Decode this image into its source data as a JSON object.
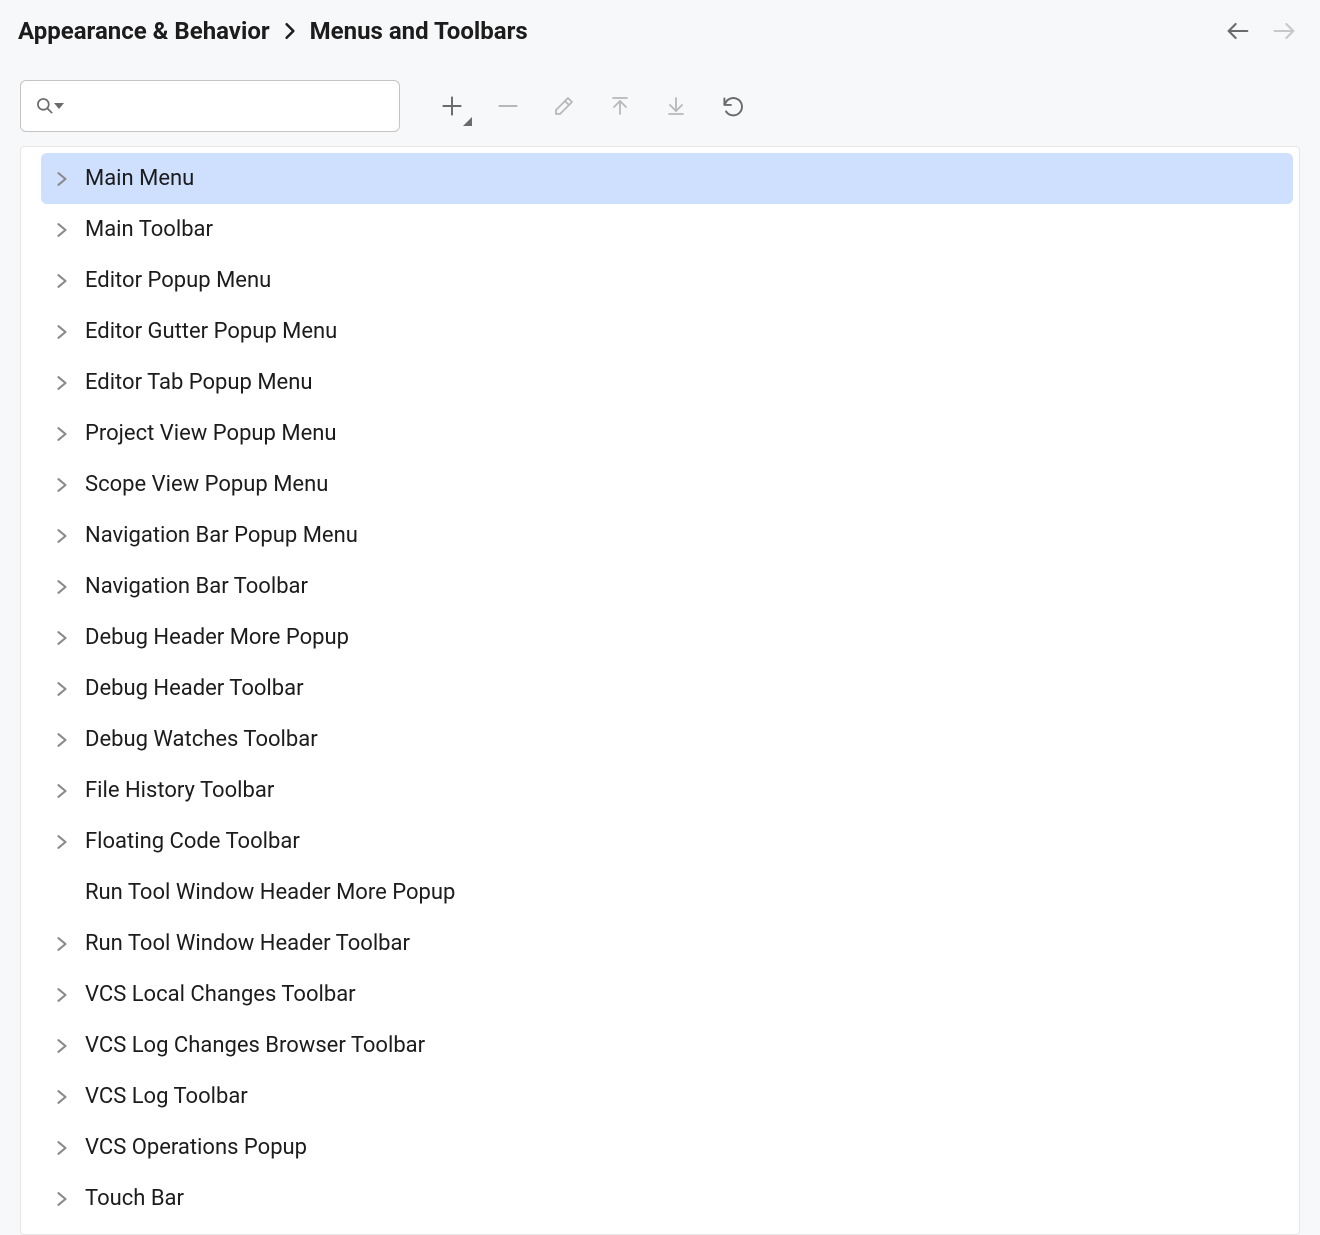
{
  "breadcrumb": {
    "parent": "Appearance & Behavior",
    "current": "Menus and Toolbars"
  },
  "search": {
    "value": "",
    "placeholder": ""
  },
  "actions": {
    "add": "Add",
    "remove": "Remove",
    "edit": "Edit",
    "move_up": "Move Up",
    "move_down": "Move Down",
    "reset": "Reset"
  },
  "selected_index": 0,
  "tree": [
    {
      "label": "Main Menu",
      "expandable": true
    },
    {
      "label": "Main Toolbar",
      "expandable": true
    },
    {
      "label": "Editor Popup Menu",
      "expandable": true
    },
    {
      "label": "Editor Gutter Popup Menu",
      "expandable": true
    },
    {
      "label": "Editor Tab Popup Menu",
      "expandable": true
    },
    {
      "label": "Project View Popup Menu",
      "expandable": true
    },
    {
      "label": "Scope View Popup Menu",
      "expandable": true
    },
    {
      "label": "Navigation Bar Popup Menu",
      "expandable": true
    },
    {
      "label": "Navigation Bar Toolbar",
      "expandable": true
    },
    {
      "label": "Debug Header More Popup",
      "expandable": true
    },
    {
      "label": "Debug Header Toolbar",
      "expandable": true
    },
    {
      "label": "Debug Watches Toolbar",
      "expandable": true
    },
    {
      "label": "File History Toolbar",
      "expandable": true
    },
    {
      "label": "Floating Code Toolbar",
      "expandable": true
    },
    {
      "label": "Run Tool Window Header More Popup",
      "expandable": false
    },
    {
      "label": "Run Tool Window Header Toolbar",
      "expandable": true
    },
    {
      "label": "VCS Local Changes Toolbar",
      "expandable": true
    },
    {
      "label": "VCS Log Changes Browser Toolbar",
      "expandable": true
    },
    {
      "label": "VCS Log Toolbar",
      "expandable": true
    },
    {
      "label": "VCS Operations Popup",
      "expandable": true
    },
    {
      "label": "Touch Bar",
      "expandable": true
    }
  ],
  "colors": {
    "selection": "#cfe0ff",
    "bg": "#f7f8fa",
    "panel": "#ffffff"
  }
}
